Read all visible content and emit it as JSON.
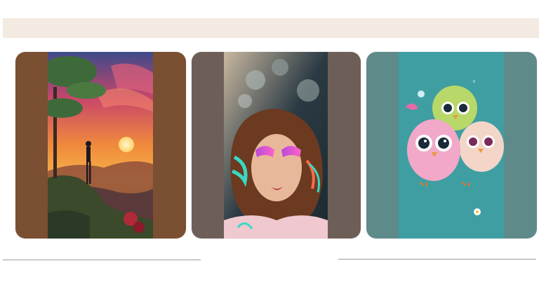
{
  "colors": {
    "top_band": "#f3eae1",
    "card_1_frame": "#7a4f32",
    "card_2_frame": "#6d5f58",
    "card_3_frame": "#5f8a8a",
    "divider": "#9a9a9a"
  },
  "gallery": {
    "items": [
      {
        "subject": "sunset-landscape-image"
      },
      {
        "subject": "neon-makeup-portrait-image"
      },
      {
        "subject": "cute-owls-image"
      }
    ]
  }
}
